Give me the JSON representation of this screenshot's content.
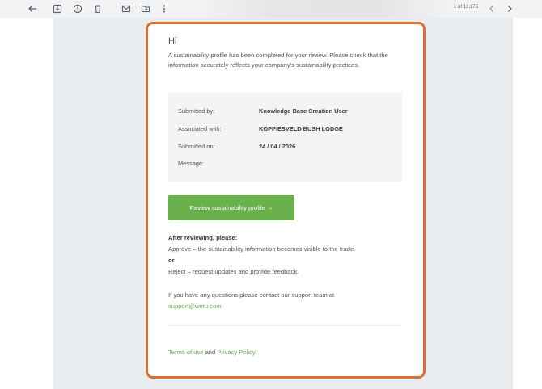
{
  "toolbar": {
    "icons": [
      "back-arrow-icon",
      "archive-icon",
      "report-spam-icon",
      "delete-icon",
      "mark-unread-icon",
      "move-to-folder-icon",
      "more-options-icon"
    ],
    "message_count": "1 of 13,175"
  },
  "email": {
    "greeting": "Hi",
    "intro": "A sustainability profile has been completed for your review. Please check that the information accurately reflects your company's sustainability practices.",
    "details": {
      "submitted_by_label": "Submitted by:",
      "submitted_by_value": "Knowledge Base Creation User",
      "associated_with_label": "Associated with:",
      "associated_with_value": "KOPPIESVELD BUSH LODGE",
      "submitted_on_label": "Submitted on:",
      "submitted_on_value": "24 / 04 / 2026",
      "message_label": "Message:"
    },
    "review_button": "Review sustainability profile  →",
    "after_title": "After reviewing, please:",
    "approve_line": "Approve – the sustainability information becomes visible to the trade.",
    "or_label": "or",
    "reject_line": "Reject – request updates and provide feedback.",
    "contact_text": "If you have any questions please contact our support team at",
    "support_email": "support@wetu.com",
    "footer": {
      "terms": "Terms of use",
      "and": " and ",
      "privacy": "Privacy Policy",
      "period": "."
    }
  },
  "colors": {
    "accent_green": "#6ab04c",
    "highlight_border": "#d9702f",
    "email_background": "#e9ecef"
  }
}
